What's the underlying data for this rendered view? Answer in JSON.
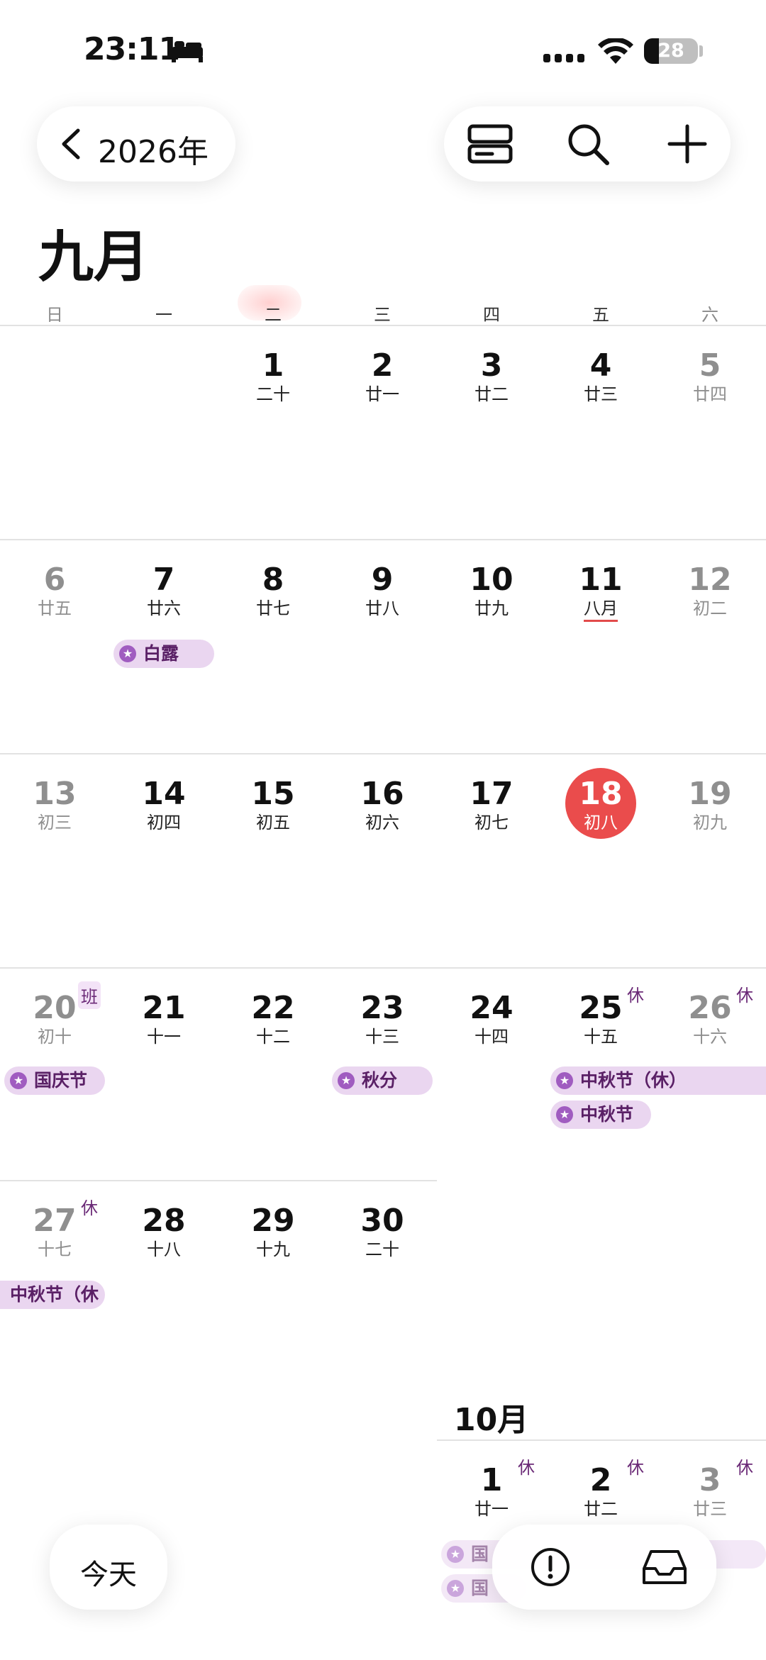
{
  "status_bar": {
    "time": "23:11",
    "battery": "28",
    "battery_level": 0.28
  },
  "header": {
    "back_label": "2026年",
    "month_title": "九月"
  },
  "toolbar": {
    "view_icon": "view-toggle-icon",
    "search_icon": "search-icon",
    "add_icon": "plus-icon"
  },
  "weekdays": [
    "日",
    "一",
    "二",
    "三",
    "四",
    "五",
    "六"
  ],
  "september": {
    "weeks": [
      [
        null,
        null,
        {
          "num": "1",
          "lunar": "二十"
        },
        {
          "num": "2",
          "lunar": "廿一"
        },
        {
          "num": "3",
          "lunar": "廿二"
        },
        {
          "num": "4",
          "lunar": "廿三"
        },
        {
          "num": "5",
          "lunar": "廿四"
        }
      ],
      [
        {
          "num": "6",
          "lunar": "廿五"
        },
        {
          "num": "7",
          "lunar": "廿六"
        },
        {
          "num": "8",
          "lunar": "廿七"
        },
        {
          "num": "9",
          "lunar": "廿八"
        },
        {
          "num": "10",
          "lunar": "廿九"
        },
        {
          "num": "11",
          "lunar": "八月"
        },
        {
          "num": "12",
          "lunar": "初二"
        }
      ],
      [
        {
          "num": "13",
          "lunar": "初三"
        },
        {
          "num": "14",
          "lunar": "初四"
        },
        {
          "num": "15",
          "lunar": "初五"
        },
        {
          "num": "16",
          "lunar": "初六"
        },
        {
          "num": "17",
          "lunar": "初七"
        },
        {
          "num": "18",
          "lunar": "初八"
        },
        {
          "num": "19",
          "lunar": "初九"
        }
      ],
      [
        {
          "num": "20",
          "lunar": "初十",
          "badge": "班"
        },
        {
          "num": "21",
          "lunar": "十一"
        },
        {
          "num": "22",
          "lunar": "十二"
        },
        {
          "num": "23",
          "lunar": "十三"
        },
        {
          "num": "24",
          "lunar": "十四"
        },
        {
          "num": "25",
          "lunar": "十五",
          "badge": "休"
        },
        {
          "num": "26",
          "lunar": "十六",
          "badge": "休"
        }
      ],
      [
        {
          "num": "27",
          "lunar": "十七",
          "badge": "休"
        },
        {
          "num": "28",
          "lunar": "十八"
        },
        {
          "num": "29",
          "lunar": "十九"
        },
        {
          "num": "30",
          "lunar": "二十"
        },
        null,
        null,
        null
      ]
    ],
    "events": {
      "bailu": "白露",
      "guoqing": "国庆节",
      "qiufen": "秋分",
      "zhongqiu_xiu": "中秋节（休）",
      "zhongqiu": "中秋节",
      "zhongqiu_cut": "中秋节（休"
    }
  },
  "october": {
    "title": "10月",
    "days": [
      {
        "num": "1",
        "lunar": "廿一",
        "badge": "休"
      },
      {
        "num": "2",
        "lunar": "廿二",
        "badge": "休"
      },
      {
        "num": "3",
        "lunar": "廿三",
        "badge": "休"
      }
    ],
    "event_cut_1": "国",
    "event_cut_2": "国"
  },
  "bottom": {
    "today_label": "今天",
    "alert_icon": "alert-icon",
    "inbox_icon": "inbox-icon"
  },
  "colors": {
    "today_red": "#ea4c4c",
    "chip_bg": "#ead6f0",
    "chip_text": "#5a2066",
    "badge": "#6b2a77"
  }
}
